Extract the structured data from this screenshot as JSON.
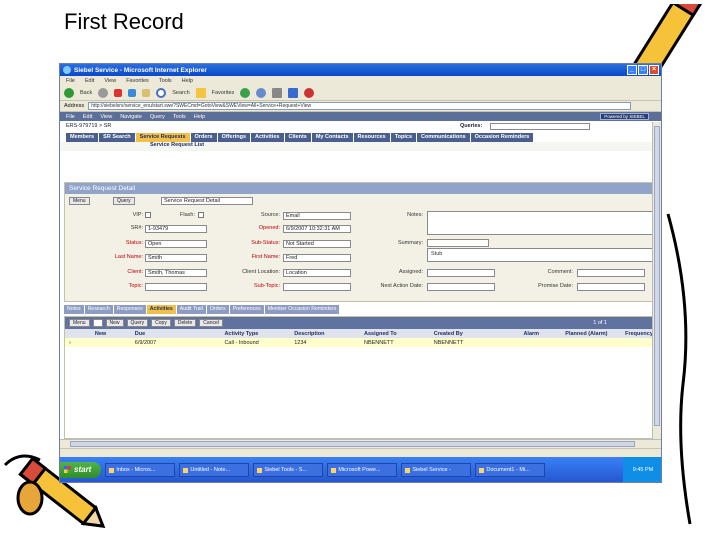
{
  "slide": {
    "title": "First Record"
  },
  "window": {
    "title": "Siebel Service - Microsoft Internet Explorer",
    "menu": [
      "File",
      "Edit",
      "View",
      "Favorites",
      "Tools",
      "Help"
    ],
    "toolbar": {
      "back": "Back",
      "search": "Search",
      "favorites": "Favorites"
    },
    "address_label": "Address",
    "address": "http://siebelsrv/service_enu/start.swe?SWECmd=GotoView&SWEView=All+Service+Request+View"
  },
  "app": {
    "menu": [
      "File",
      "Edit",
      "View",
      "Navigate",
      "Query",
      "Tools",
      "Help"
    ],
    "logo": "Powered by SIEBEL",
    "breadcrumb": "ERS-979719 > SR",
    "queries_label": "Queries:",
    "tabs": [
      "Members",
      "SR Search",
      "Service Requests",
      "Orders",
      "Offerings",
      "Activities",
      "Clients",
      "My Contacts",
      "Resources",
      "Topics",
      "Communications",
      "Occasion Reminders"
    ],
    "active_tab": "Service Requests",
    "subtab": "Service Request List"
  },
  "detail": {
    "header": "Service Request Detail",
    "menu_btn": "Menu",
    "query_btn": "Query",
    "view_select": "Service Request Detail",
    "fields": {
      "vip_label": "VIP:",
      "flash_label": "Flash:",
      "sr_label": "SR#:",
      "sr_value": "1-93479",
      "status_label": "Status:",
      "status_value": "Open",
      "last_name_label": "Last Name:",
      "last_name_value": "Smith",
      "client_label": "Client:",
      "client_value": "Smith, Thomas",
      "topic_label": "Topic:",
      "substatus_label": "Sub-Status:",
      "substatus_value": "Not Started",
      "first_name_label": "First Name:",
      "first_name_value": "Fred",
      "client_location_label": "Client Location:",
      "client_location_value": "Location",
      "subtopic_label": "Sub-Topic:",
      "source_label": "Source:",
      "source_value": "Email",
      "opened_label": "Opened:",
      "opened_value": "6/9/2007 10:32:31 AM",
      "notes_label": "Notes:",
      "summary_label": "Summary:",
      "summary_value": "Stub",
      "assigned_label": "Assigned:",
      "next_action_label": "Next Action Date:",
      "comment_label": "Comment:",
      "promise_label": "Promise Date:"
    }
  },
  "view_tabs": [
    "Notes",
    "Research",
    "Responses",
    "Activities",
    "Audit Trail",
    "Orders",
    "Preferences",
    "Member Occasion Reminders"
  ],
  "active_view_tab": "Activities",
  "list": {
    "buttons": [
      "Menu",
      "New",
      "Query",
      "Copy",
      "Delete",
      "Cancel"
    ],
    "count": "1 of 1",
    "columns": [
      "New",
      "Due",
      "Activity Type",
      "Description",
      "Assigned To",
      "Created By",
      "Alarm",
      "Planned (Alarm)",
      "Frequency"
    ],
    "rows": [
      [
        "",
        "6/9/2007",
        "Call - Inbound",
        "1234",
        "NBENNETT",
        "NBENNETT",
        "",
        "",
        ""
      ]
    ]
  },
  "taskbar": {
    "start": "start",
    "tasks": [
      "Inbox - Micros...",
      "Untitled - Note...",
      "Siebel Tools - S...",
      "Microsoft Powe...",
      "Siebel Service -",
      "Document1 - Mi..."
    ],
    "clock": "9:45 PM"
  }
}
